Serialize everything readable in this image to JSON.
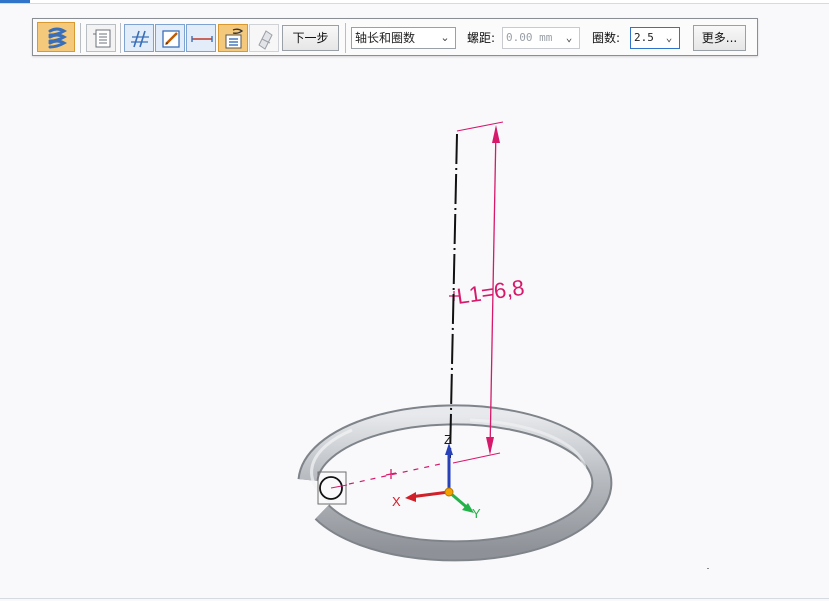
{
  "toolbar": {
    "step_label": "下一步",
    "method": {
      "value": "轴长和圈数"
    },
    "pitch": {
      "label": "螺距:",
      "value": "0.00 mm"
    },
    "turns": {
      "label": "圈数:",
      "value": "2.5"
    },
    "more_label": "更多..."
  },
  "viewport": {
    "dimension_label": "L1=6,8",
    "axis_labels": {
      "x": "X",
      "y": "Y",
      "z": "Z"
    },
    "colors": {
      "dimension": "#d6196b",
      "axis_x": "#d0202a",
      "axis_y": "#24b24a",
      "axis_z": "#2840b8",
      "origin": "#f2a200",
      "helix_tube": "#b9bdc2"
    }
  }
}
